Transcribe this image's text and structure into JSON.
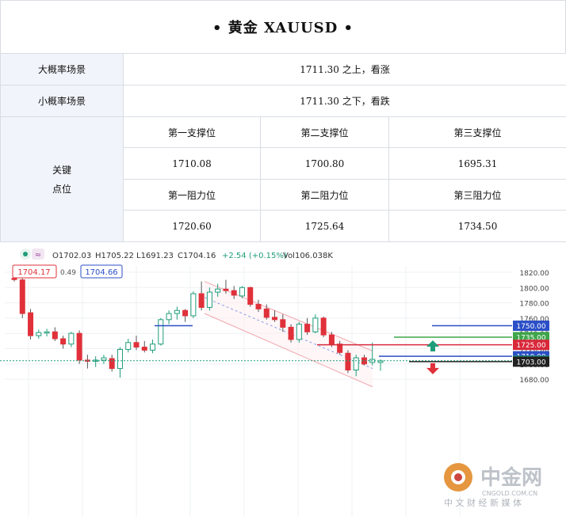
{
  "title": "•  黄金 XAUUSD   •",
  "table": {
    "rows": [
      {
        "label": "大概率场景",
        "value": "1711.30 之上，看涨"
      },
      {
        "label": "小概率场景",
        "value": "1711.30 之下，看跌"
      }
    ],
    "key_label_1": "关键",
    "key_label_2": "点位",
    "support_headers": [
      "第一支撑位",
      "第二支撑位",
      "第三支撑位"
    ],
    "support_values": [
      "1710.08",
      "1700.80",
      "1695.31"
    ],
    "resistance_headers": [
      "第一阻力位",
      "第二阻力位",
      "第三阻力位"
    ],
    "resistance_values": [
      "1720.60",
      "1725.64",
      "1734.50"
    ]
  },
  "chart_data": {
    "type": "candlestick",
    "symbol": "XAUUSD",
    "ohlc_header": {
      "o": "O1702.03",
      "h": "H1705.22",
      "l": "L1691.23",
      "c": "C1704.16",
      "chg": "+2.54 (+0.15%)",
      "vol": "Vol106.038K"
    },
    "price_boxes": {
      "left": "1704.17",
      "spread": "0.49",
      "right": "1704.66"
    },
    "ylim": [
      1677,
      1822
    ],
    "y_ticks": [
      "1820.00",
      "1800.00",
      "1780.00",
      "1760.00",
      "1740.00",
      "1720.00",
      "1700.00",
      "1680.00"
    ],
    "bull_color": "#1f9d7a",
    "bear_color": "#e0313b",
    "candles": [
      {
        "o": 1812,
        "h": 1815,
        "l": 1808,
        "c": 1811
      },
      {
        "o": 1810,
        "h": 1812,
        "l": 1760,
        "c": 1766
      },
      {
        "o": 1767,
        "h": 1772,
        "l": 1732,
        "c": 1737
      },
      {
        "o": 1737,
        "h": 1745,
        "l": 1733,
        "c": 1741
      },
      {
        "o": 1741,
        "h": 1746,
        "l": 1736,
        "c": 1742
      },
      {
        "o": 1742,
        "h": 1748,
        "l": 1730,
        "c": 1733
      },
      {
        "o": 1733,
        "h": 1737,
        "l": 1720,
        "c": 1726
      },
      {
        "o": 1726,
        "h": 1742,
        "l": 1722,
        "c": 1740
      },
      {
        "o": 1740,
        "h": 1744,
        "l": 1700,
        "c": 1705
      },
      {
        "o": 1705,
        "h": 1712,
        "l": 1694,
        "c": 1704
      },
      {
        "o": 1704,
        "h": 1710,
        "l": 1696,
        "c": 1705
      },
      {
        "o": 1705,
        "h": 1712,
        "l": 1700,
        "c": 1708
      },
      {
        "o": 1707,
        "h": 1712,
        "l": 1690,
        "c": 1694
      },
      {
        "o": 1694,
        "h": 1722,
        "l": 1682,
        "c": 1719
      },
      {
        "o": 1719,
        "h": 1733,
        "l": 1715,
        "c": 1728
      },
      {
        "o": 1728,
        "h": 1737,
        "l": 1718,
        "c": 1722
      },
      {
        "o": 1722,
        "h": 1730,
        "l": 1715,
        "c": 1718
      },
      {
        "o": 1718,
        "h": 1732,
        "l": 1714,
        "c": 1726
      },
      {
        "o": 1726,
        "h": 1760,
        "l": 1724,
        "c": 1758
      },
      {
        "o": 1758,
        "h": 1770,
        "l": 1752,
        "c": 1766
      },
      {
        "o": 1766,
        "h": 1775,
        "l": 1758,
        "c": 1770
      },
      {
        "o": 1770,
        "h": 1772,
        "l": 1755,
        "c": 1763
      },
      {
        "o": 1763,
        "h": 1795,
        "l": 1760,
        "c": 1792
      },
      {
        "o": 1792,
        "h": 1808,
        "l": 1770,
        "c": 1774
      },
      {
        "o": 1774,
        "h": 1800,
        "l": 1770,
        "c": 1794
      },
      {
        "o": 1794,
        "h": 1805,
        "l": 1788,
        "c": 1798
      },
      {
        "o": 1798,
        "h": 1810,
        "l": 1792,
        "c": 1796
      },
      {
        "o": 1796,
        "h": 1802,
        "l": 1785,
        "c": 1790
      },
      {
        "o": 1789,
        "h": 1802,
        "l": 1786,
        "c": 1800
      },
      {
        "o": 1800,
        "h": 1801,
        "l": 1775,
        "c": 1778
      },
      {
        "o": 1778,
        "h": 1784,
        "l": 1768,
        "c": 1772
      },
      {
        "o": 1772,
        "h": 1778,
        "l": 1758,
        "c": 1761
      },
      {
        "o": 1761,
        "h": 1770,
        "l": 1755,
        "c": 1758
      },
      {
        "o": 1758,
        "h": 1765,
        "l": 1742,
        "c": 1748
      },
      {
        "o": 1748,
        "h": 1752,
        "l": 1728,
        "c": 1732
      },
      {
        "o": 1732,
        "h": 1755,
        "l": 1728,
        "c": 1752
      },
      {
        "o": 1752,
        "h": 1760,
        "l": 1738,
        "c": 1742
      },
      {
        "o": 1742,
        "h": 1765,
        "l": 1740,
        "c": 1760
      },
      {
        "o": 1760,
        "h": 1762,
        "l": 1735,
        "c": 1738
      },
      {
        "o": 1738,
        "h": 1742,
        "l": 1722,
        "c": 1726
      },
      {
        "o": 1726,
        "h": 1730,
        "l": 1712,
        "c": 1715
      },
      {
        "o": 1714,
        "h": 1718,
        "l": 1688,
        "c": 1692
      },
      {
        "o": 1692,
        "h": 1712,
        "l": 1684,
        "c": 1708
      },
      {
        "o": 1708,
        "h": 1712,
        "l": 1698,
        "c": 1700
      },
      {
        "o": 1702,
        "h": 1728,
        "l": 1698,
        "c": 1706
      },
      {
        "o": 1702,
        "h": 1706,
        "l": 1691,
        "c": 1704
      }
    ],
    "levels": [
      {
        "label": "1750.00",
        "value": 1750,
        "color": "#2b4fc7"
      },
      {
        "label": "1735.00",
        "value": 1735,
        "color": "#3ea54a"
      },
      {
        "label": "1725.00",
        "value": 1725,
        "color": "#d8283a"
      },
      {
        "label": "1710.00",
        "value": 1710,
        "color": "#2b4fc7"
      },
      {
        "label": "1704.16",
        "value": 1704.16,
        "color": "#1f9d7a"
      },
      {
        "label": "1703.00",
        "value": 1703,
        "color": "#222222"
      }
    ],
    "watermark": {
      "brand": "中金网",
      "site": "CNGOLD.COM.CN",
      "tagline": "中 文 财 经 新 媒 体"
    }
  }
}
